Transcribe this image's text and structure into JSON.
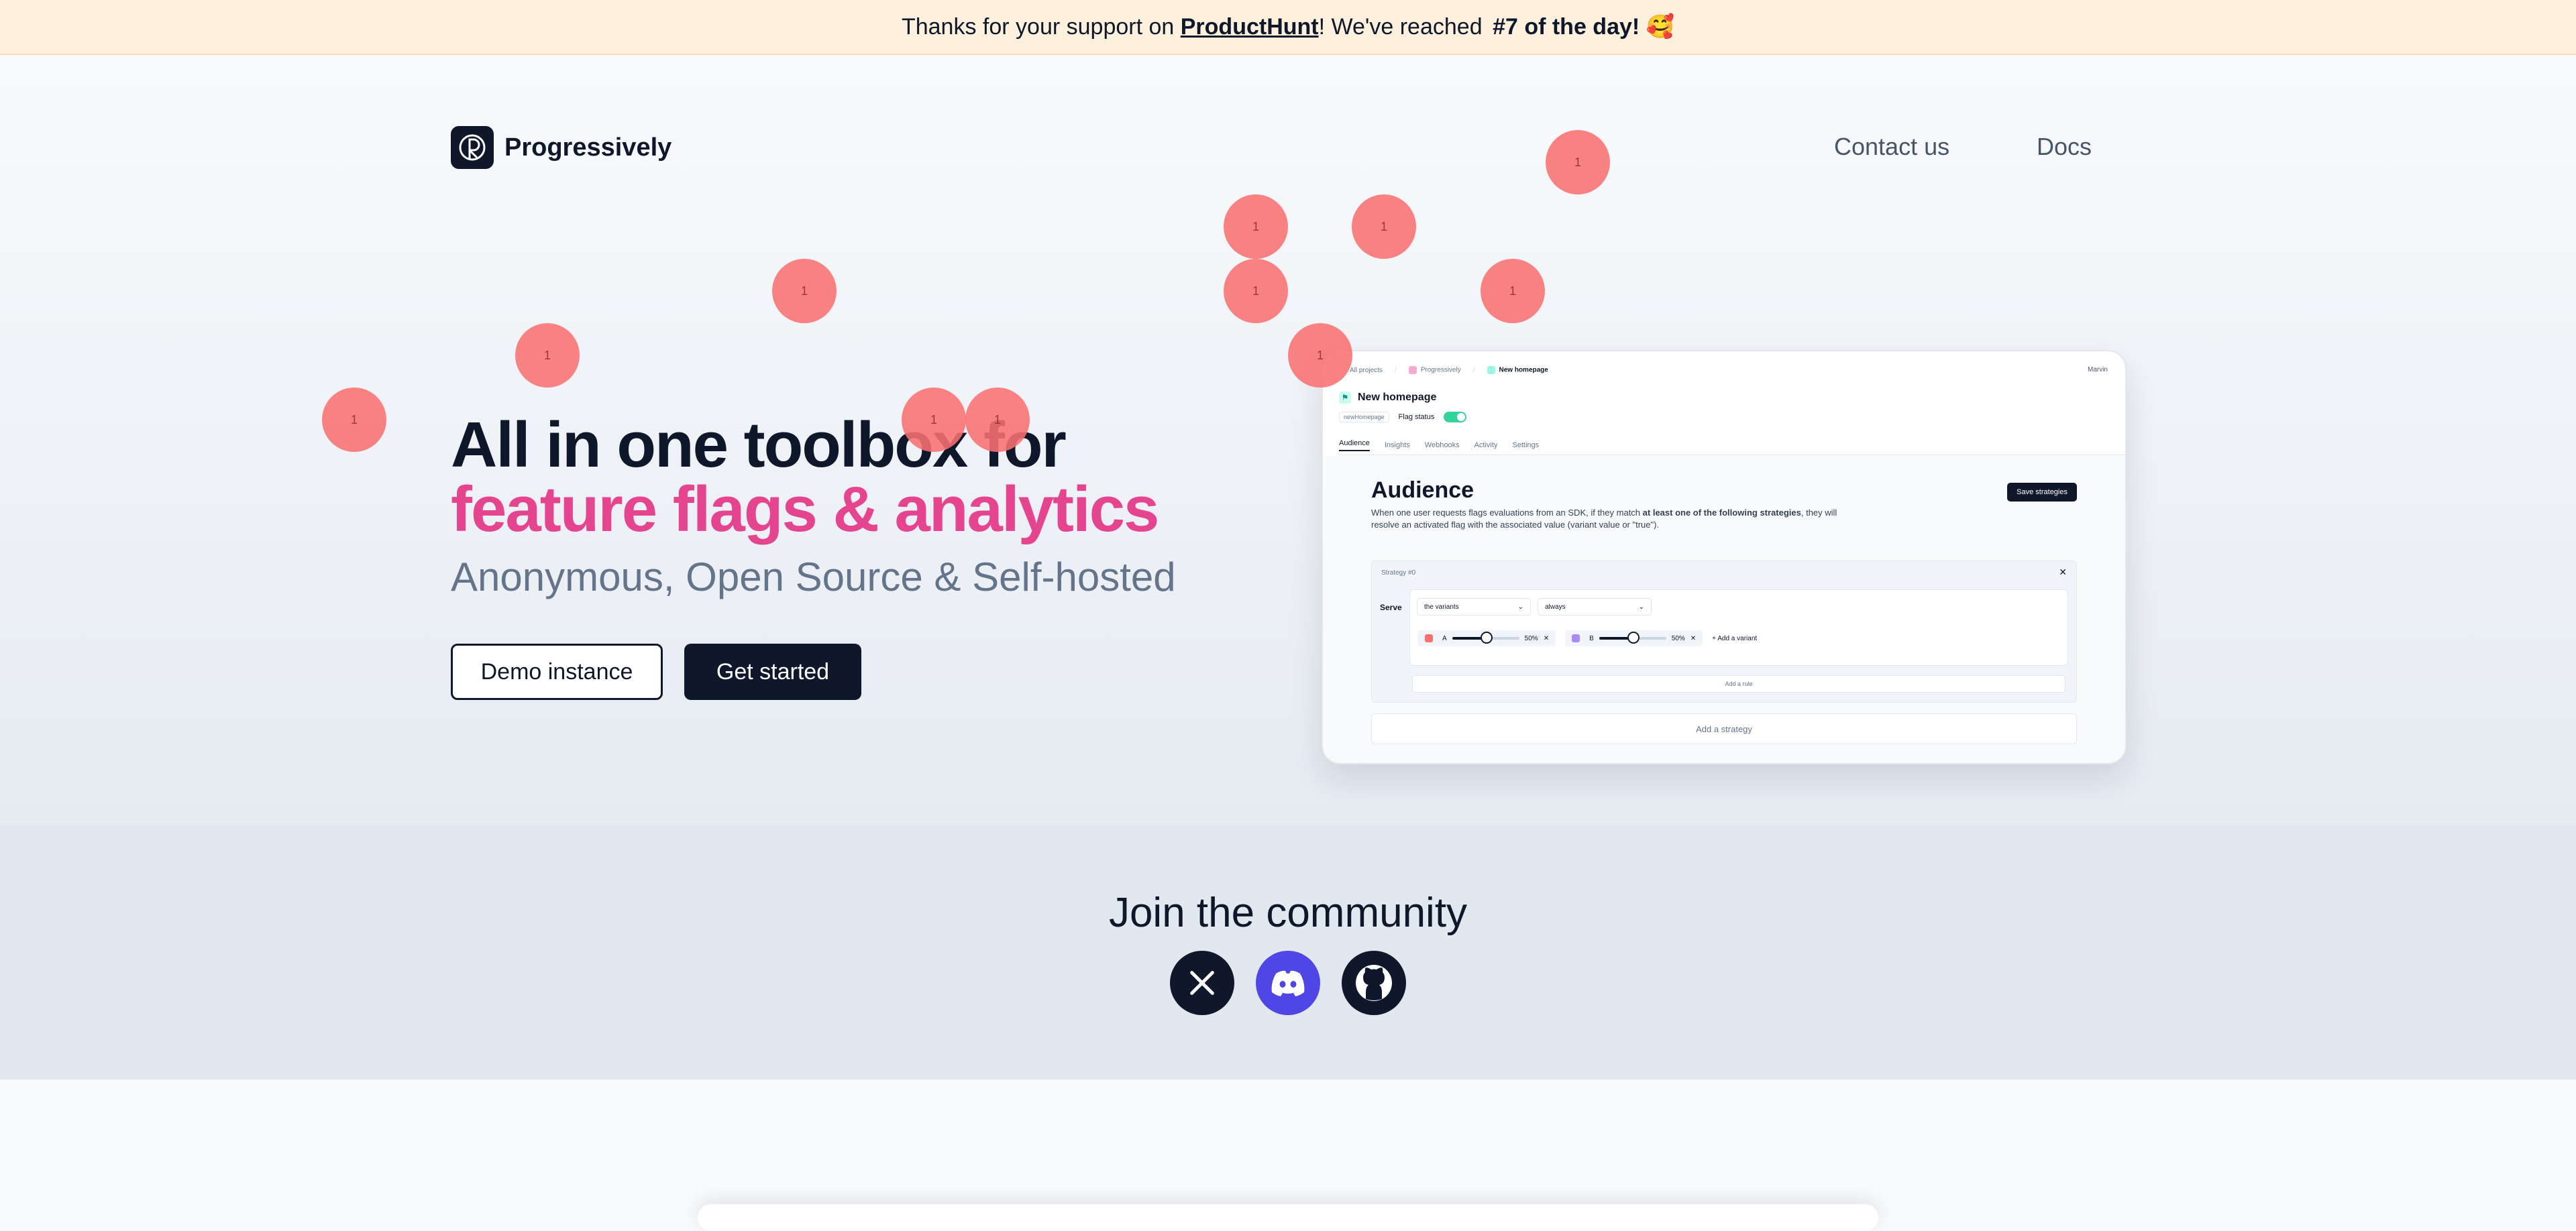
{
  "banner": {
    "prefix": "Thanks for your support on",
    "link": "ProductHunt",
    "middle": "! We've reached",
    "highlight": "#7 of the day!",
    "emoji": "🥰"
  },
  "brand": {
    "name": "Progressively",
    "icon": "progressively-logo-icon"
  },
  "nav": {
    "contact": "Contact us",
    "docs": "Docs"
  },
  "hero": {
    "title_line1": "All in one toolbox for",
    "title_line2": "feature flags & analytics",
    "subtitle": "Anonymous, Open Source & Self-hosted",
    "demo_button": "Demo instance",
    "start_button": "Get started",
    "accent_color": "#e5448f"
  },
  "mock": {
    "breadcrumbs": [
      "All projects",
      "Progressively",
      "New homepage"
    ],
    "user": "Marvin",
    "flag_name": "New homepage",
    "flag_key": "newHomepage",
    "flag_status_label": "Flag status",
    "flag_status": "on",
    "tabs": [
      "Audience",
      "Insights",
      "Webhooks",
      "Activity",
      "Settings"
    ],
    "active_tab": "Audience",
    "heading": "Audience",
    "description_start": "When one user requests flags evaluations from an SDK, if they match ",
    "description_bold1": "at least one of the following strategies",
    "description_end": ", they will resolve an activated flag with the associated value (variant value or \"true\").",
    "save_button": "Save strategies",
    "strategy_title": "Strategy #0",
    "serve_label": "Serve",
    "serve_select": "the variants",
    "when_select": "always",
    "variants": [
      {
        "name": "A",
        "percent": "50%",
        "color": "#f87171"
      },
      {
        "name": "B",
        "percent": "50%",
        "color": "#a78bfa"
      }
    ],
    "add_variant": "Add a variant",
    "add_rule": "Add a rule",
    "add_strategy": "Add a strategy"
  },
  "community": {
    "title": "Join the community",
    "links": [
      {
        "name": "x-twitter-icon",
        "color": "#0f172a"
      },
      {
        "name": "discord-icon",
        "color": "#4f46e5"
      },
      {
        "name": "github-icon",
        "color": "#0f172a"
      }
    ]
  },
  "bubbles": {
    "label": "1",
    "count": 12,
    "color": "#f87171"
  }
}
